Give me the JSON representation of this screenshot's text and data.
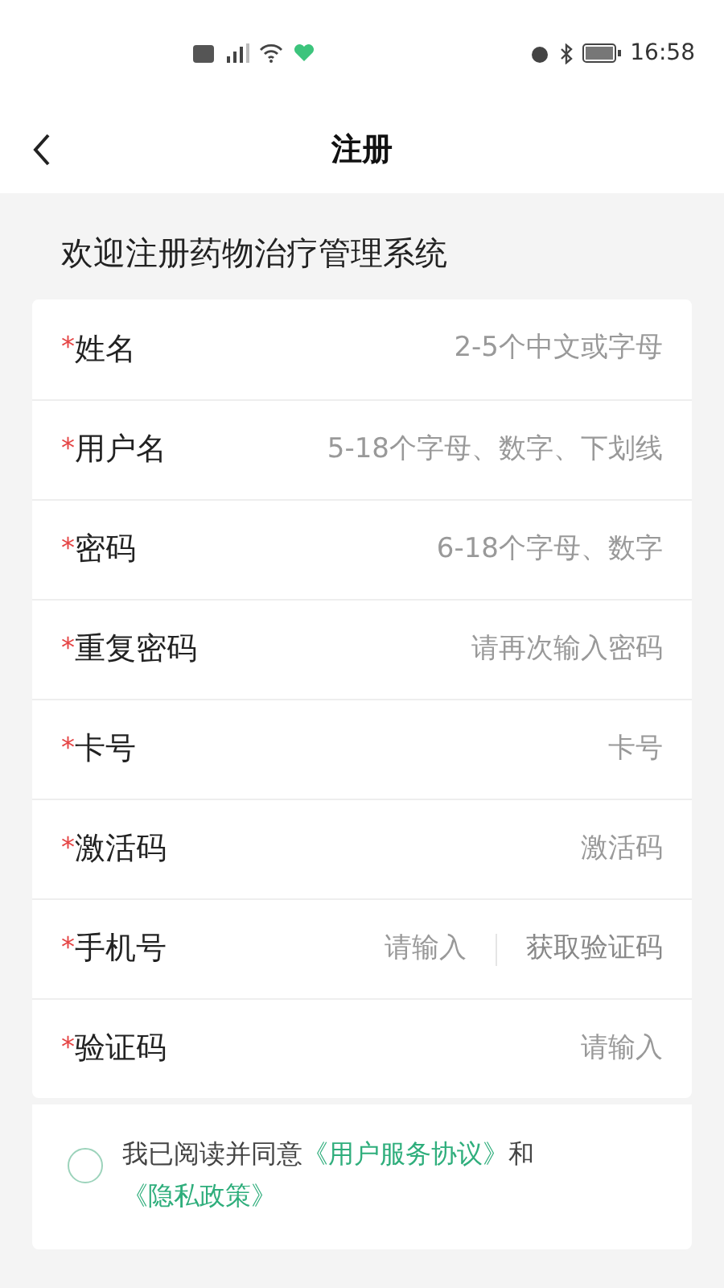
{
  "status_bar": {
    "time": "16:58"
  },
  "header": {
    "title": "注册"
  },
  "subtitle": "欢迎注册药物治疗管理系统",
  "fields": [
    {
      "kind": "text",
      "label": "姓名",
      "required_mark": "*",
      "placeholder": "2-5个中文或字母"
    },
    {
      "kind": "text",
      "label": "用户名",
      "required_mark": "*",
      "placeholder": "5-18个字母、数字、下划线"
    },
    {
      "kind": "text",
      "label": "密码",
      "required_mark": "*",
      "placeholder": "6-18个字母、数字"
    },
    {
      "kind": "text",
      "label": "重复密码",
      "required_mark": "*",
      "placeholder": "请再次输入密码"
    },
    {
      "kind": "text",
      "label": "卡号",
      "required_mark": "*",
      "placeholder": "卡号"
    },
    {
      "kind": "text",
      "label": "激活码",
      "required_mark": "*",
      "placeholder": "激活码"
    },
    {
      "kind": "code",
      "label": "手机号",
      "required_mark": "*",
      "placeholder": "请输入",
      "button": "获取验证码"
    },
    {
      "kind": "text",
      "label": "验证码",
      "required_mark": "*",
      "placeholder": "请输入"
    }
  ],
  "agreement": {
    "checked": false,
    "text": "我已阅读并同意",
    "link_1": "《用户服务协议》",
    "joiner": "和",
    "link_2": "《隐私政策》"
  }
}
